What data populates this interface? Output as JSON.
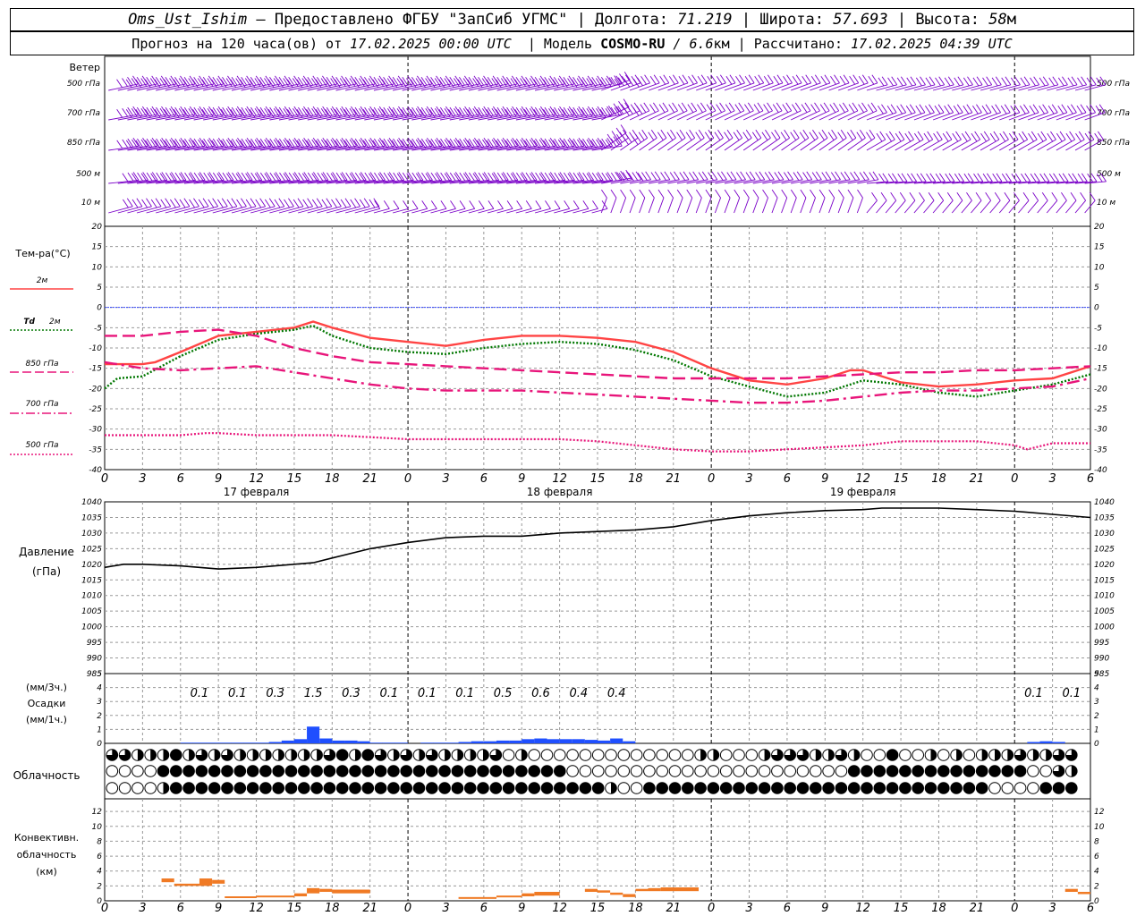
{
  "header": {
    "station": "Oms_Ust_Ishim",
    "provided_by": " – Предоставлено ФГБУ \"ЗапСиб УГМС\" | Долгота: ",
    "lon": "71.219",
    "lat_label": " | Широта: ",
    "lat": "57.693",
    "alt_label": " | Высота: ",
    "alt": "58",
    "alt_unit": "м",
    "forecast_label": "Прогноз на 120 часа(ов) от ",
    "forecast_from": "17.02.2025 00:00 UTC",
    "model_label": "  | Модель ",
    "model": "COSMO-RU",
    "model_res": " / 6.6",
    "model_res_unit": "км",
    "calc_label": " | Рассчитано: ",
    "calc_time": "17.02.2025 04:39 UTC"
  },
  "labels": {
    "wind": "Ветер",
    "wind_levels": [
      "500 гПа",
      "700 гПа",
      "850 гПа",
      "500 м",
      "10  м"
    ],
    "temp": "Тем-ра(°C)",
    "temp_2m": "2м",
    "td": "Td",
    "td_2m": "2м",
    "t850": "850 гПа",
    "t700": "700 гПа",
    "t500": "500 гПа",
    "pressure": "Давление",
    "pressure_unit": "(гПа)",
    "precip_3h": "(мм/3ч.)",
    "precip": "Осадки",
    "precip_1h": "(мм/1ч.)",
    "cloud": "Облачность",
    "conv1": "Конвективн.",
    "conv2": "облачность",
    "conv3": "(км)",
    "days": [
      "17 февраля",
      "18 февраля",
      "19 февраля"
    ],
    "hour_ticks": [
      "0",
      "3",
      "6",
      "9",
      "12",
      "15",
      "18",
      "21",
      "0",
      "3",
      "6",
      "9",
      "12",
      "15",
      "18",
      "21",
      "0",
      "3",
      "6",
      "9",
      "12",
      "15",
      "18",
      "21",
      "0",
      "3",
      "6"
    ]
  },
  "colors": {
    "t2m": "#ff4444",
    "td2m": "#007700",
    "levels": "#e8157a",
    "wind": "#7a00c8",
    "zero": "#3344ff",
    "precip": "#1f4fff",
    "conv": "#f07a24"
  },
  "chart_data": {
    "type": "line",
    "x_range_hours": [
      0,
      78
    ],
    "temperature": {
      "ylim": [
        -40,
        20
      ],
      "yticks": [
        20,
        15,
        10,
        5,
        0,
        -5,
        -10,
        -15,
        -20,
        -25,
        -30,
        -35,
        -40
      ],
      "series": [
        {
          "key": "t2m",
          "name": "2м",
          "style": "solid",
          "x": [
            0,
            3,
            4,
            6,
            9,
            12,
            15,
            16.5,
            18,
            21,
            24,
            27,
            30,
            33,
            36,
            39,
            42,
            45,
            48,
            51,
            54,
            57,
            59,
            60,
            63,
            66,
            69,
            72,
            75,
            78
          ],
          "y": [
            -14,
            -14,
            -13.5,
            -11,
            -7,
            -6,
            -5,
            -3.5,
            -5,
            -7.5,
            -8.5,
            -9.5,
            -8,
            -7,
            -7,
            -7.5,
            -8.5,
            -11,
            -15,
            -18,
            -19,
            -17.5,
            -15.5,
            -15.5,
            -18.5,
            -19.5,
            -19,
            -18,
            -17.5,
            -14.5
          ]
        },
        {
          "key": "td2m",
          "name": "Td 2м",
          "style": "dotted",
          "x": [
            0,
            1,
            3,
            6,
            9,
            12,
            15,
            16.5,
            18,
            21,
            24,
            27,
            30,
            33,
            36,
            39,
            42,
            45,
            48,
            51,
            54,
            57,
            60,
            63,
            66,
            69,
            72,
            75,
            78
          ],
          "y": [
            -20,
            -17.5,
            -17,
            -12,
            -8,
            -6.5,
            -5.5,
            -4.5,
            -7,
            -10,
            -11,
            -11.5,
            -10,
            -9,
            -8.5,
            -9,
            -10.5,
            -13,
            -17,
            -19.5,
            -22,
            -21,
            -18,
            -19,
            -21,
            -22,
            -20.5,
            -19,
            -16.5
          ]
        },
        {
          "key": "t850",
          "name": "850 гПа",
          "style": "dash",
          "x": [
            0,
            3,
            6,
            9,
            12,
            15,
            18,
            21,
            24,
            27,
            30,
            33,
            36,
            39,
            42,
            45,
            48,
            51,
            54,
            57,
            60,
            63,
            66,
            69,
            72,
            75,
            78
          ],
          "y": [
            -7,
            -7,
            -6,
            -5.5,
            -7,
            -10,
            -12,
            -13.5,
            -14,
            -14.5,
            -15,
            -15.5,
            -16,
            -16.5,
            -17,
            -17.5,
            -17.5,
            -17.5,
            -17.5,
            -17,
            -16.5,
            -16,
            -16,
            -15.5,
            -15.5,
            -15,
            -14.5
          ]
        },
        {
          "key": "t700",
          "name": "700 гПа",
          "style": "dashdot",
          "x": [
            0,
            3,
            6,
            9,
            12,
            15,
            18,
            21,
            24,
            27,
            30,
            33,
            36,
            39,
            42,
            45,
            48,
            51,
            54,
            57,
            60,
            63,
            66,
            69,
            72,
            75,
            78
          ],
          "y": [
            -13.5,
            -15,
            -15.5,
            -15,
            -14.5,
            -16,
            -17.5,
            -19,
            -20,
            -20.5,
            -20.5,
            -20.5,
            -21,
            -21.5,
            -22,
            -22.5,
            -23,
            -23.5,
            -23.5,
            -23,
            -22,
            -21,
            -20.5,
            -20.5,
            -20,
            -19.5,
            -17.5
          ]
        },
        {
          "key": "t500",
          "name": "500 гПа",
          "style": "dotted",
          "x": [
            0,
            3,
            6,
            8,
            9,
            12,
            15,
            18,
            21,
            24,
            27,
            30,
            33,
            36,
            39,
            42,
            45,
            48,
            51,
            54,
            57,
            60,
            63,
            66,
            69,
            72,
            73,
            75,
            78
          ],
          "y": [
            -31.5,
            -31.5,
            -31.5,
            -31,
            -31,
            -31.5,
            -31.5,
            -31.5,
            -32,
            -32.5,
            -32.5,
            -32.5,
            -32.5,
            -32.5,
            -33,
            -34,
            -35,
            -35.5,
            -35.5,
            -35,
            -34.5,
            -34,
            -33,
            -33,
            -33,
            -34,
            -35,
            -33.5,
            -33.5
          ]
        }
      ]
    },
    "pressure": {
      "name": "Давление",
      "ylim": [
        985,
        1040
      ],
      "yticks": [
        1040,
        1035,
        1030,
        1025,
        1020,
        1015,
        1010,
        1005,
        1000,
        995,
        990,
        985
      ],
      "x": [
        0,
        1.5,
        3,
        6,
        9,
        12,
        15,
        16.5,
        18,
        21,
        24,
        27,
        30,
        33,
        36,
        39,
        42,
        45,
        48,
        51,
        54,
        57,
        60,
        61.5,
        63,
        66,
        69,
        72,
        75,
        78
      ],
      "y": [
        1019,
        1020,
        1020,
        1019.5,
        1018.5,
        1019,
        1020,
        1020.5,
        1022,
        1025,
        1027,
        1028.5,
        1029,
        1029,
        1030,
        1030.5,
        1031,
        1032,
        1034,
        1035.5,
        1036.5,
        1037.2,
        1037.5,
        1038,
        1038,
        1038,
        1037.5,
        1037,
        1036,
        1035
      ]
    },
    "precipitation": {
      "ylim": [
        0,
        5
      ],
      "yticks": [
        5,
        4,
        3,
        2,
        1,
        0
      ],
      "sum_3h": [
        {
          "x": 7.5,
          "label": "0.1"
        },
        {
          "x": 10.5,
          "label": "0.1"
        },
        {
          "x": 13.5,
          "label": "0.3"
        },
        {
          "x": 16.5,
          "label": "1.5"
        },
        {
          "x": 19.5,
          "label": "0.3"
        },
        {
          "x": 22.5,
          "label": "0.1"
        },
        {
          "x": 25.5,
          "label": "0.1"
        },
        {
          "x": 28.5,
          "label": "0.1"
        },
        {
          "x": 31.5,
          "label": "0.5"
        },
        {
          "x": 34.5,
          "label": "0.6"
        },
        {
          "x": 37.5,
          "label": "0.4"
        },
        {
          "x": 40.5,
          "label": "0.4"
        },
        {
          "x": 73.5,
          "label": "0.1"
        },
        {
          "x": 76.5,
          "label": "0.1"
        }
      ],
      "hourly": [
        [
          6,
          0.05
        ],
        [
          7,
          0.05
        ],
        [
          8,
          0.05
        ],
        [
          9,
          0.05
        ],
        [
          10,
          0.05
        ],
        [
          11,
          0.05
        ],
        [
          12,
          0.05
        ],
        [
          13,
          0.1
        ],
        [
          14,
          0.2
        ],
        [
          15,
          0.3
        ],
        [
          16,
          1.2
        ],
        [
          17,
          0.35
        ],
        [
          18,
          0.2
        ],
        [
          19,
          0.2
        ],
        [
          20,
          0.15
        ],
        [
          21,
          0.05
        ],
        [
          22,
          0.05
        ],
        [
          23,
          0.05
        ],
        [
          25,
          0.05
        ],
        [
          26,
          0.05
        ],
        [
          27,
          0.05
        ],
        [
          28,
          0.1
        ],
        [
          29,
          0.15
        ],
        [
          30,
          0.15
        ],
        [
          31,
          0.2
        ],
        [
          32,
          0.2
        ],
        [
          33,
          0.3
        ],
        [
          34,
          0.35
        ],
        [
          35,
          0.3
        ],
        [
          36,
          0.3
        ],
        [
          37,
          0.3
        ],
        [
          38,
          0.25
        ],
        [
          39,
          0.2
        ],
        [
          40,
          0.35
        ],
        [
          41,
          0.15
        ],
        [
          73,
          0.1
        ],
        [
          74,
          0.15
        ],
        [
          75,
          0.1
        ]
      ]
    },
    "cloud_rows": [
      "3311121313111111132123131311113010000000000000110001333113100200101011131133",
      "0000222222222222222222222222222222220000000000000000000000222222222222220031",
      "0000122222222222222222222222222222222221002222222222222222222222222220000222"
    ],
    "convective": {
      "ylim": [
        0,
        13
      ],
      "yticks": [
        12,
        10,
        8,
        6,
        4,
        2,
        0
      ],
      "segments": [
        [
          4.5,
          5.5,
          2.5,
          3.0
        ],
        [
          5.5,
          7.5,
          2.0,
          2.3
        ],
        [
          7.5,
          8.5,
          2.0,
          3.0
        ],
        [
          8.5,
          9.5,
          2.3,
          2.8
        ],
        [
          9.5,
          12,
          0.4,
          0.6
        ],
        [
          12,
          15,
          0.5,
          0.7
        ],
        [
          15,
          16,
          0.6,
          1.0
        ],
        [
          16,
          17,
          1.0,
          1.7
        ],
        [
          17,
          18,
          1.2,
          1.6
        ],
        [
          18,
          21,
          1.0,
          1.5
        ],
        [
          28,
          31,
          0.3,
          0.5
        ],
        [
          31,
          33,
          0.5,
          0.7
        ],
        [
          33,
          34,
          0.6,
          1.0
        ],
        [
          34,
          36,
          0.7,
          1.2
        ],
        [
          38,
          39,
          1.2,
          1.6
        ],
        [
          39,
          40,
          1.1,
          1.4
        ],
        [
          40,
          41,
          0.8,
          1.1
        ],
        [
          41,
          42,
          0.5,
          0.9
        ],
        [
          42,
          43,
          1.3,
          1.6
        ],
        [
          43,
          44,
          1.3,
          1.7
        ],
        [
          44,
          47,
          1.3,
          1.8
        ],
        [
          76,
          77,
          1.2,
          1.6
        ],
        [
          77,
          78,
          0.9,
          1.2
        ]
      ]
    },
    "wind_rows": [
      "500 гПа",
      "700 гПа",
      "850 гПа",
      "500 м",
      "10 м"
    ]
  }
}
